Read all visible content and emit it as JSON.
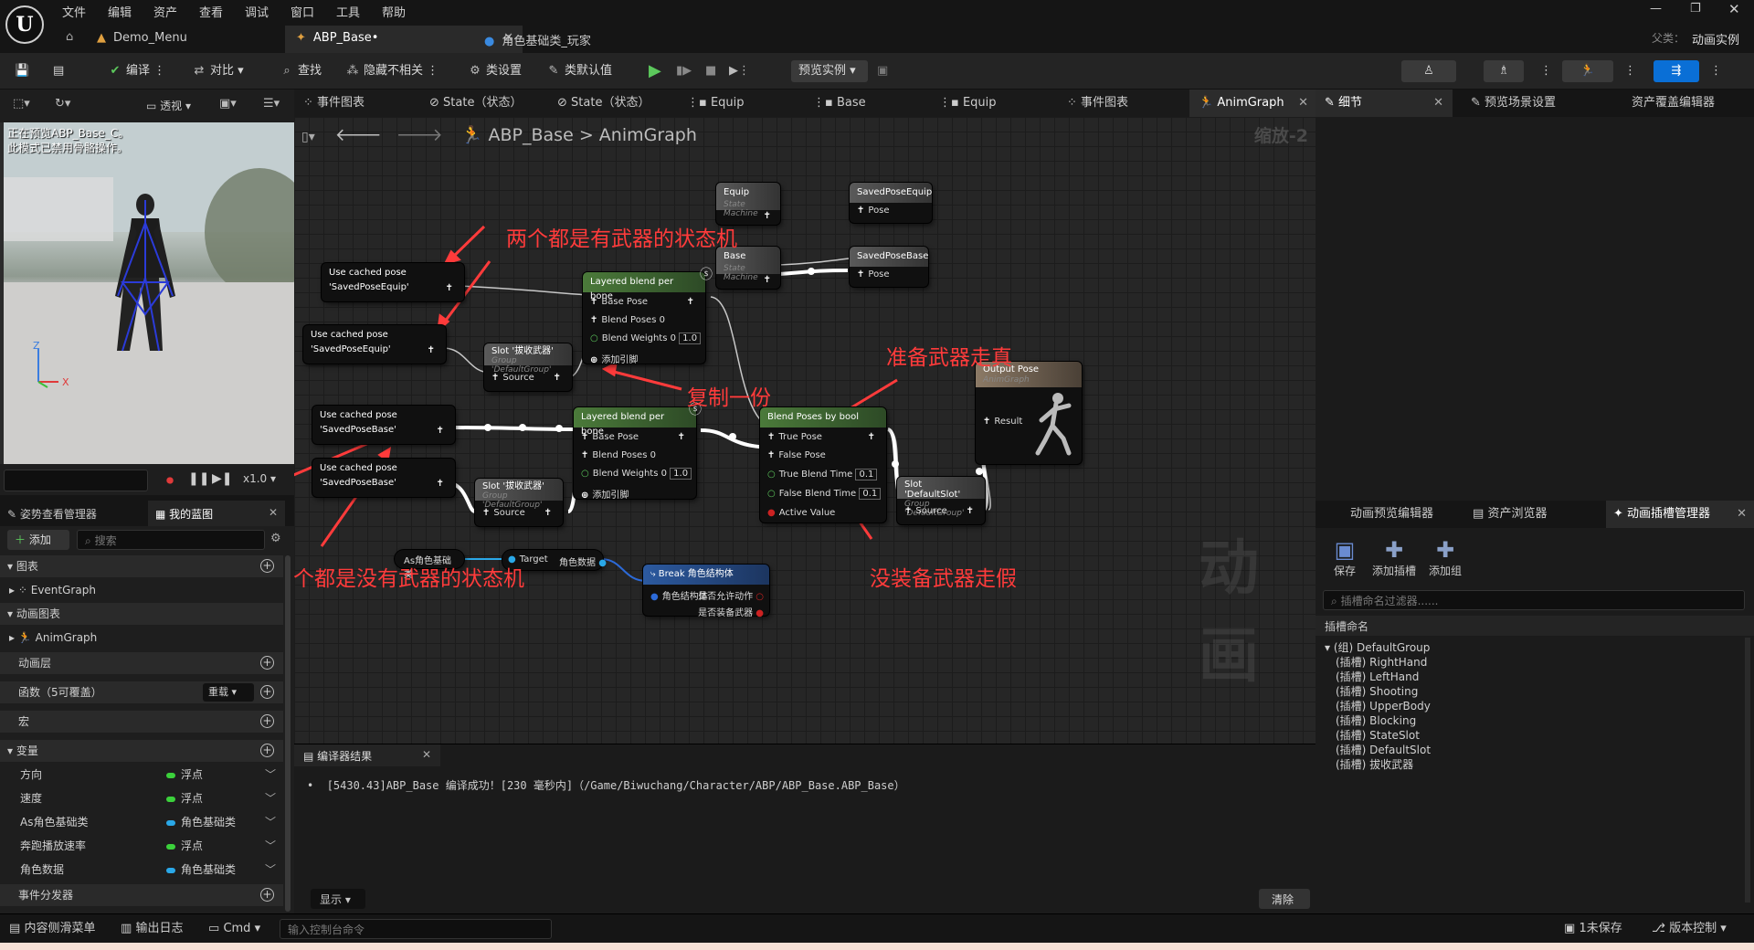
{
  "menu": {
    "items": [
      "文件",
      "编辑",
      "资产",
      "查看",
      "调试",
      "窗口",
      "工具",
      "帮助"
    ]
  },
  "logo": "U",
  "window": {
    "parent_label": "父类：",
    "parent_value": "动画实例"
  },
  "doc_tabs": [
    {
      "label": "Demo_Menu"
    },
    {
      "label": "ABP_Base•"
    },
    {
      "label": "角色基础类_玩家"
    }
  ],
  "toolbar": {
    "compile": "编译",
    "diff": "对比",
    "find": "查找",
    "hide_unrelated": "隐藏不相关",
    "class_settings": "类设置",
    "class_defaults": "类默认值",
    "preview_instance": "预览实例"
  },
  "viewport": {
    "view_mode": "透视",
    "preview_text_line1": "正在预览ABP_Base_C。",
    "preview_text_line2": "此模式已禁用骨骼操作。",
    "axis_z": "Z",
    "axis_x": "X",
    "speed": "x1.0"
  },
  "left_panel": {
    "tab_pose": "姿势查看管理器",
    "tab_bp": "我的蓝图",
    "add_label": "添加",
    "search_placeholder": "搜索",
    "section_graphs": "图表",
    "event_graph": "EventGraph",
    "section_anim_graphs": "动画图表",
    "anim_graph": "AnimGraph",
    "section_anim_layers": "动画层",
    "section_functions": "函数（5可覆盖）",
    "override_label": "重载",
    "section_macros": "宏",
    "section_variables": "变量",
    "variables": [
      {
        "name": "方向",
        "type": "浮点",
        "color": "#3bd13b"
      },
      {
        "name": "速度",
        "type": "浮点",
        "color": "#3bd13b"
      },
      {
        "name": "As角色基础类",
        "type": "角色基础类",
        "color": "#2aa8e8"
      },
      {
        "name": "奔跑播放速率",
        "type": "浮点",
        "color": "#3bd13b"
      },
      {
        "name": "角色数据",
        "type": "角色基础类",
        "color": "#2aa8e8"
      }
    ],
    "section_event_dispatchers": "事件分发器"
  },
  "graph_tabs": [
    {
      "label": "事件图表"
    },
    {
      "label": "State（状态）"
    },
    {
      "label": "State（状态）"
    },
    {
      "label": "Equip"
    },
    {
      "label": "Base"
    },
    {
      "label": "Equip"
    },
    {
      "label": "事件图表"
    },
    {
      "label": "AnimGraph"
    }
  ],
  "graph": {
    "breadcrumb_root": "ABP_Base",
    "breadcrumb_sep": ">",
    "breadcrumb_leaf": "AnimGraph",
    "zoom": "缩放-2",
    "watermark": "动画",
    "nodes": {
      "equip_sm": {
        "title": "Equip",
        "sub": "State Machine"
      },
      "saved_equip": {
        "title": "SavedPoseEquip",
        "pin": "Pose"
      },
      "base_sm": {
        "title": "Base",
        "sub": "State Machine"
      },
      "saved_base": {
        "title": "SavedPoseBase",
        "pin": "Pose"
      },
      "cached_equip_1": {
        "title": "Use cached pose 'SavedPoseEquip'"
      },
      "cached_equip_2": {
        "title": "Use cached pose 'SavedPoseEquip'"
      },
      "cached_base_1": {
        "title": "Use cached pose 'SavedPoseBase'"
      },
      "cached_base_2": {
        "title": "Use cached pose 'SavedPoseBase'"
      },
      "slot_1": {
        "title": "Slot '拔收武器'",
        "sub": "Group 'DefaultGroup'",
        "pin": "Source"
      },
      "slot_2": {
        "title": "Slot '拔收武器'",
        "sub": "Group 'DefaultGroup'",
        "pin": "Source"
      },
      "layered_1": {
        "title": "Layered blend per bone",
        "pins": [
          "Base Pose",
          "Blend Poses 0",
          "Blend Weights 0"
        ],
        "weight": "1.0",
        "add_pin": "添加引脚"
      },
      "layered_2": {
        "title": "Layered blend per bone",
        "pins": [
          "Base Pose",
          "Blend Poses 0",
          "Blend Weights 0"
        ],
        "weight": "1.0",
        "add_pin": "添加引脚"
      },
      "blend_bool": {
        "title": "Blend Poses by bool",
        "pins": [
          "True Pose",
          "False Pose",
          "True Blend Time",
          "False Blend Time",
          "Active Value"
        ],
        "true_time": "0.1",
        "false_time": "0.1"
      },
      "default_slot": {
        "title": "Slot 'DefaultSlot'",
        "sub": "Group 'DefaultGroup'",
        "pin": "Source"
      },
      "output": {
        "title": "Output Pose",
        "sub": "AnimGraph",
        "pin": "Result"
      },
      "as_var": {
        "title": "As角色基础类"
      },
      "cast": {
        "pin_target": "Target",
        "pin_out": "角色数据"
      },
      "break": {
        "title": "Break 角色结构体",
        "pin_in": "角色结构体",
        "out1": "是否允许动作",
        "out2": "是否装备武器"
      }
    },
    "annotations": {
      "top": "两个都是有武器的状态机",
      "copy": "复制一份",
      "true_label": "准备武器走真",
      "bottom": "两个都是没有武器的状态机",
      "false_label": "没装备武器走假"
    }
  },
  "compiler": {
    "tab": "编译器结果",
    "message": "[5430.43]ABP_Base 编译成功！[230 毫秒内]（/Game/Biwuchang/Character/ABP/ABP_Base.ABP_Base）",
    "show_label": "显示",
    "clear_label": "清除"
  },
  "details": {
    "tab_details": "细节",
    "tab_preview_scene": "预览场景设置",
    "tab_asset_override": "资产覆盖编辑器"
  },
  "slot_manager": {
    "tab_anim_preview": "动画预览编辑器",
    "tab_asset_browser": "资产浏览器",
    "tab_slot_manager": "动画插槽管理器",
    "save": "保存",
    "add_slot": "添加插槽",
    "add_group": "添加组",
    "filter_placeholder": "插槽命名过滤器......",
    "column_header": "插槽命名",
    "group": "(组) DefaultGroup",
    "slots": [
      "(插槽) RightHand",
      "(插槽) LeftHand",
      "(插槽) Shooting",
      "(插槽) UpperBody",
      "(插槽) Blocking",
      "(插槽) StateSlot",
      "(插槽) DefaultSlot",
      "(插槽) 拔收武器"
    ]
  },
  "statusbar": {
    "content_drawer": "内容侧滑菜单",
    "output_log": "输出日志",
    "cmd": "Cmd",
    "console_placeholder": "输入控制台命令",
    "unsaved": "1未保存",
    "source_control": "版本控制"
  },
  "colors": {
    "accent": "#0a6fd6",
    "annotation": "#ff3b3b",
    "node_green": "#4b7a3a",
    "pose_wire": "#ffffff"
  }
}
